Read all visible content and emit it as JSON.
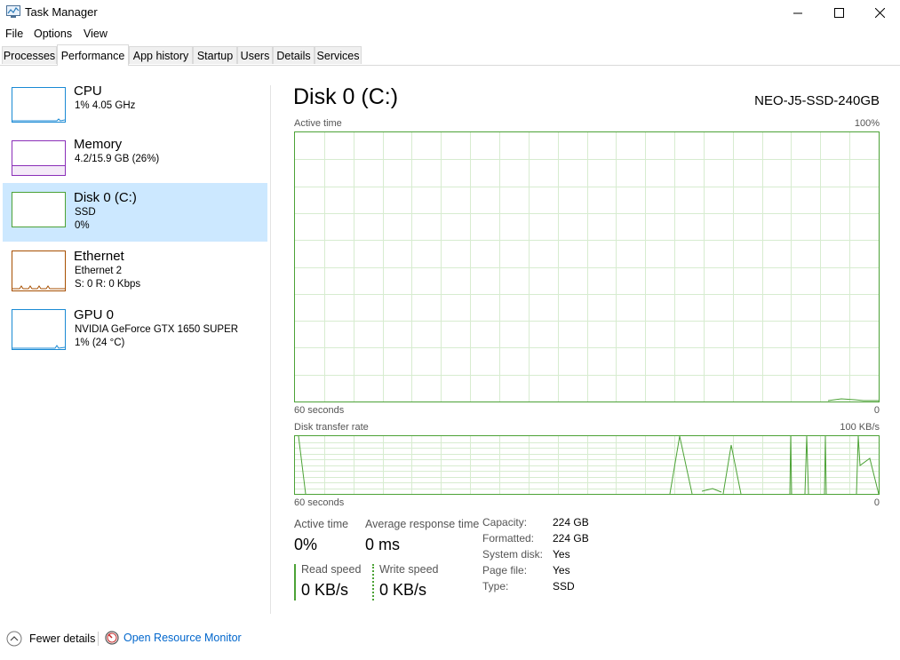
{
  "window": {
    "title": "Task Manager"
  },
  "menu": [
    "File",
    "Options",
    "View"
  ],
  "tabs": [
    "Processes",
    "Performance",
    "App history",
    "Startup",
    "Users",
    "Details",
    "Services"
  ],
  "sidebar": [
    {
      "title": "CPU",
      "line1": "1%  4.05 GHz",
      "line2": "",
      "color": "#1a8ad4"
    },
    {
      "title": "Memory",
      "line1": "4.2/15.9 GB (26%)",
      "line2": "",
      "color": "#8a2eb8"
    },
    {
      "title": "Disk 0 (C:)",
      "line1": "SSD",
      "line2": "0%",
      "color": "#4ca236"
    },
    {
      "title": "Ethernet",
      "line1": "Ethernet 2",
      "line2": "S: 0  R: 0 Kbps",
      "color": "#a74f01"
    },
    {
      "title": "GPU 0",
      "line1": "NVIDIA GeForce GTX 1650 SUPER",
      "line2": "1%  (24 °C)",
      "color": "#1a8ad4"
    }
  ],
  "main": {
    "title": "Disk 0 (C:)",
    "model": "NEO-J5-SSD-240GB",
    "graph1": {
      "label": "Active time",
      "max": "100%",
      "time": "60 seconds",
      "zero": "0"
    },
    "graph2": {
      "label": "Disk transfer rate",
      "max": "100 KB/s",
      "time": "60 seconds",
      "zero": "0"
    },
    "stats": {
      "active_label": "Active time",
      "active_val": "0%",
      "resp_label": "Average response time",
      "resp_val": "0 ms",
      "read_label": "Read speed",
      "read_val": "0 KB/s",
      "write_label": "Write speed",
      "write_val": "0 KB/s"
    },
    "props": [
      {
        "k": "Capacity:",
        "v": "224 GB"
      },
      {
        "k": "Formatted:",
        "v": "224 GB"
      },
      {
        "k": "System disk:",
        "v": "Yes"
      },
      {
        "k": "Page file:",
        "v": "Yes"
      },
      {
        "k": "Type:",
        "v": "SSD"
      }
    ]
  },
  "footer": {
    "fewer": "Fewer details",
    "monitor": "Open Resource Monitor"
  },
  "colors": {
    "accent": "#4ca236",
    "selection": "#cce8ff",
    "link": "#0066cc"
  }
}
